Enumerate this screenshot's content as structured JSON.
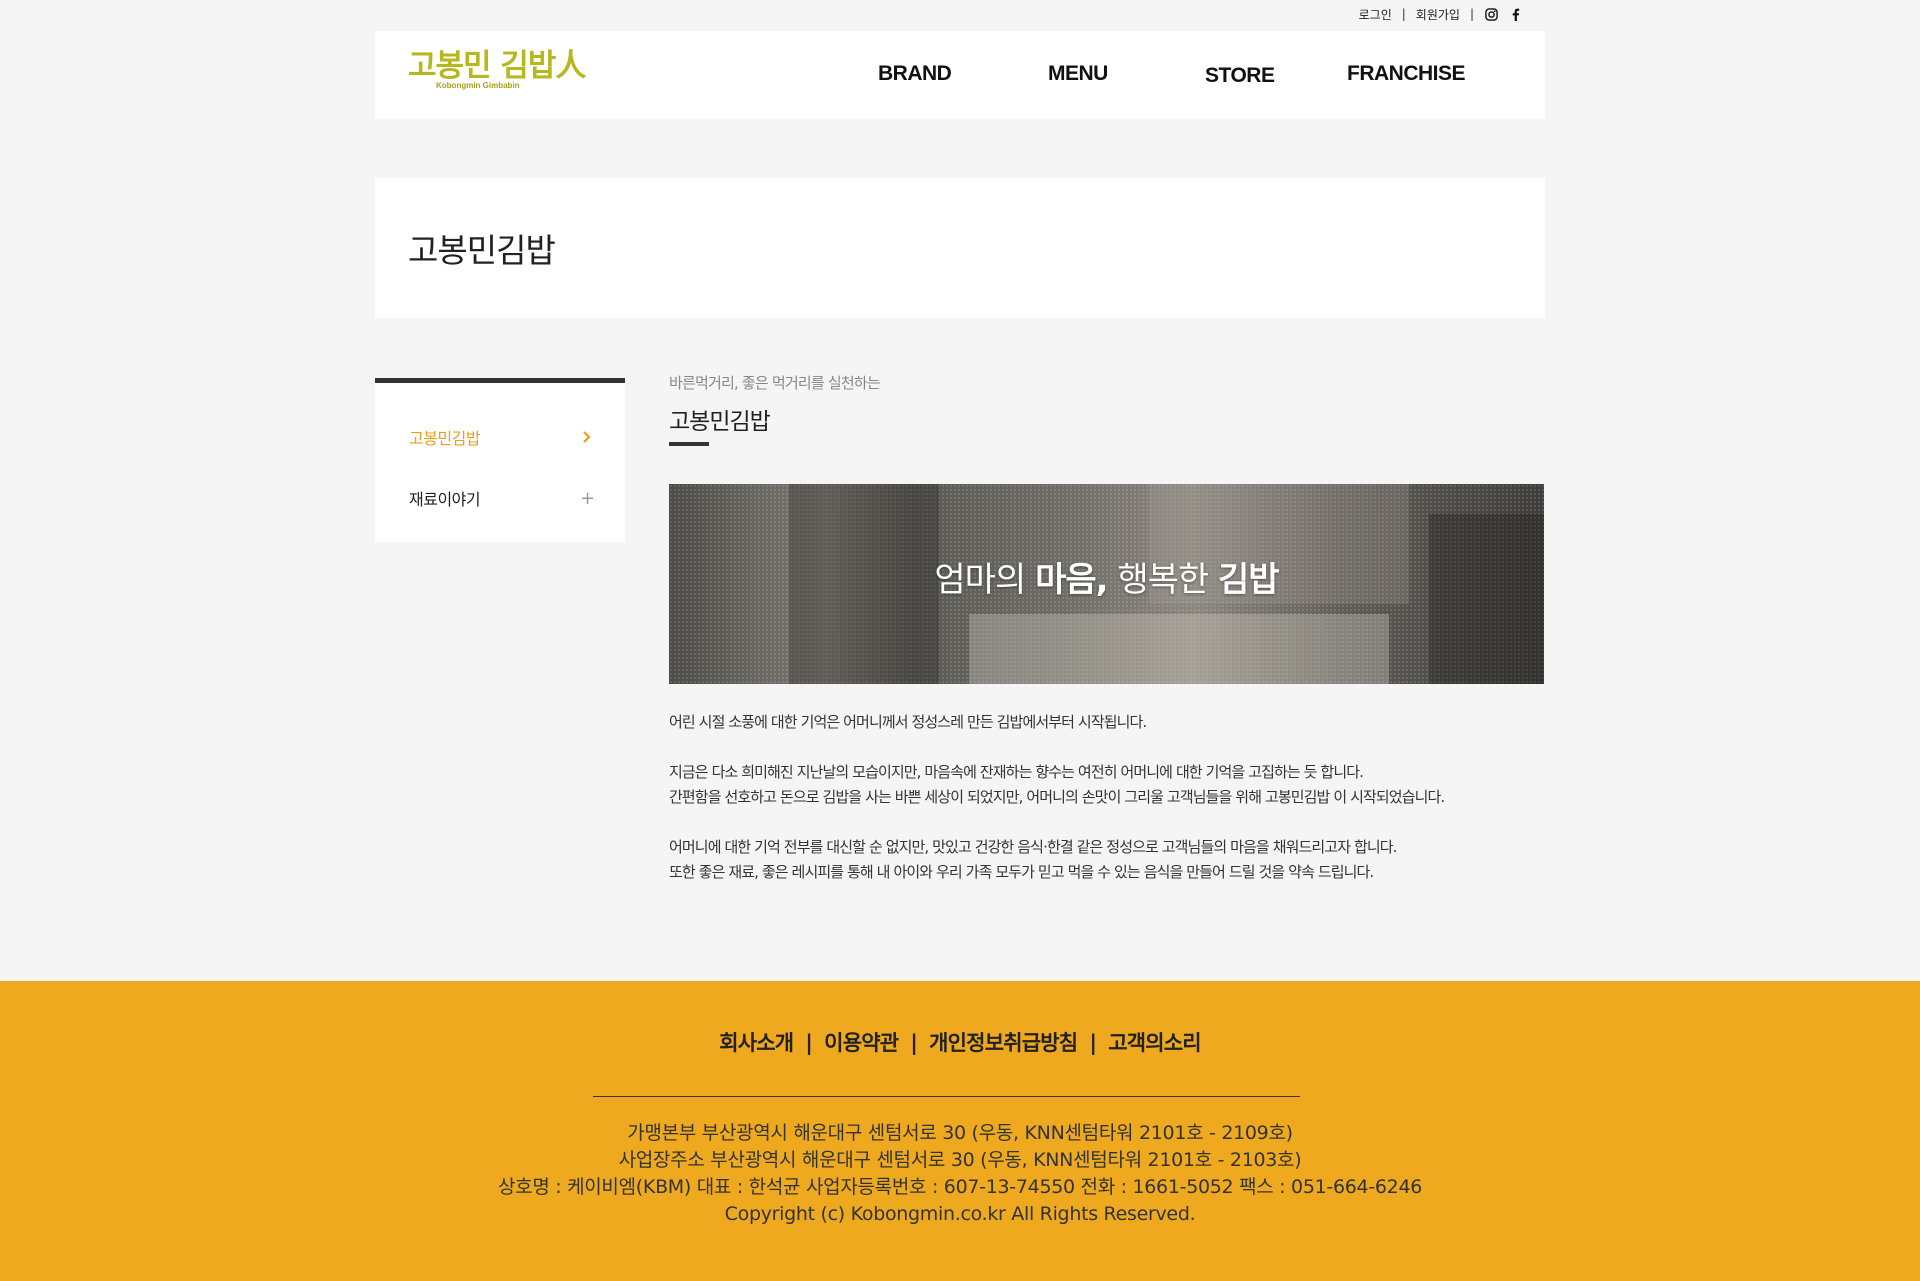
{
  "topbar": {
    "login": "로그인",
    "signup": "회원가입",
    "separator": "|",
    "icons": [
      "instagram-icon",
      "facebook-icon"
    ]
  },
  "header": {
    "logo_text": "고봉민 김밥人",
    "logo_sub": "Kobongmin Gimbabin",
    "nav": [
      "BRAND",
      "MENU",
      "STORE",
      "FRANCHISE"
    ]
  },
  "page_title": "고봉민김밥",
  "lnb": {
    "items": [
      {
        "label": "고봉민김밥",
        "mark": "›",
        "active": true
      },
      {
        "label": "재료이야기",
        "mark": "+",
        "active": false
      }
    ]
  },
  "content": {
    "caption": "바른먹거리, 좋은 먹거리를 실천하는",
    "title": "고봉민김밥",
    "banner": {
      "part1": "엄마의 ",
      "part2": "마음,",
      "part3": " 행복한 ",
      "part4": "김밥"
    },
    "paragraphs": {
      "p1": "어린 시절 소풍에 대한 기억은 어머니께서 정성스레 만든 김밥에서부터 시작됩니다.",
      "p2": "지금은 다소 희미해진 지난날의 모습이지만, 마음속에 잔재하는 향수는 여전히 어머니에 대한 기억을 고집하는 듯 합니다.",
      "p3": "간편함을 선호하고 돈으로 김밥을 사는 바쁜 세상이 되었지만, 어머니의 손맛이 그리울 고객님들을 위해 고봉민김밥 이 시작되었습니다.",
      "p4": "어머니에 대한 기억 전부를 대신할 순 없지만, 맛있고 건강한 음식·한결 같은 정성으로 고객님들의 마음을 채워드리고자 합니다.",
      "p5": "또한 좋은 재료, 좋은 레시피를 통해 내 아이와 우리 가족 모두가 믿고 먹을 수 있는 음식을 만들어 드릴 것을 약속 드립니다."
    }
  },
  "footer": {
    "links": [
      "회사소개",
      "이용약관",
      "개인정보취급방침",
      "고객의소리"
    ],
    "separator": "|",
    "info": [
      "가맹본부 부산광역시 해운대구 센텀서로 30 (우동, KNN센텀타워 2101호 - 2109호)",
      "사업장주소 부산광역시 해운대구 센텀서로 30 (우동, KNN센텀타워 2101호 - 2103호)",
      "상호명 : 케이비엠(KBM) 대표 : 한석균 사업자등록번호 : 607-13-74550 전화 : 1661-5052 팩스 : 051-664-6246",
      "Copyright (c) Kobongmin.co.kr All Rights Reserved."
    ]
  },
  "colors": {
    "accent": "#e8a01f",
    "footer_bg": "#eea91f",
    "logo": "#b7b81f",
    "page_bg": "#f5f5f5"
  }
}
